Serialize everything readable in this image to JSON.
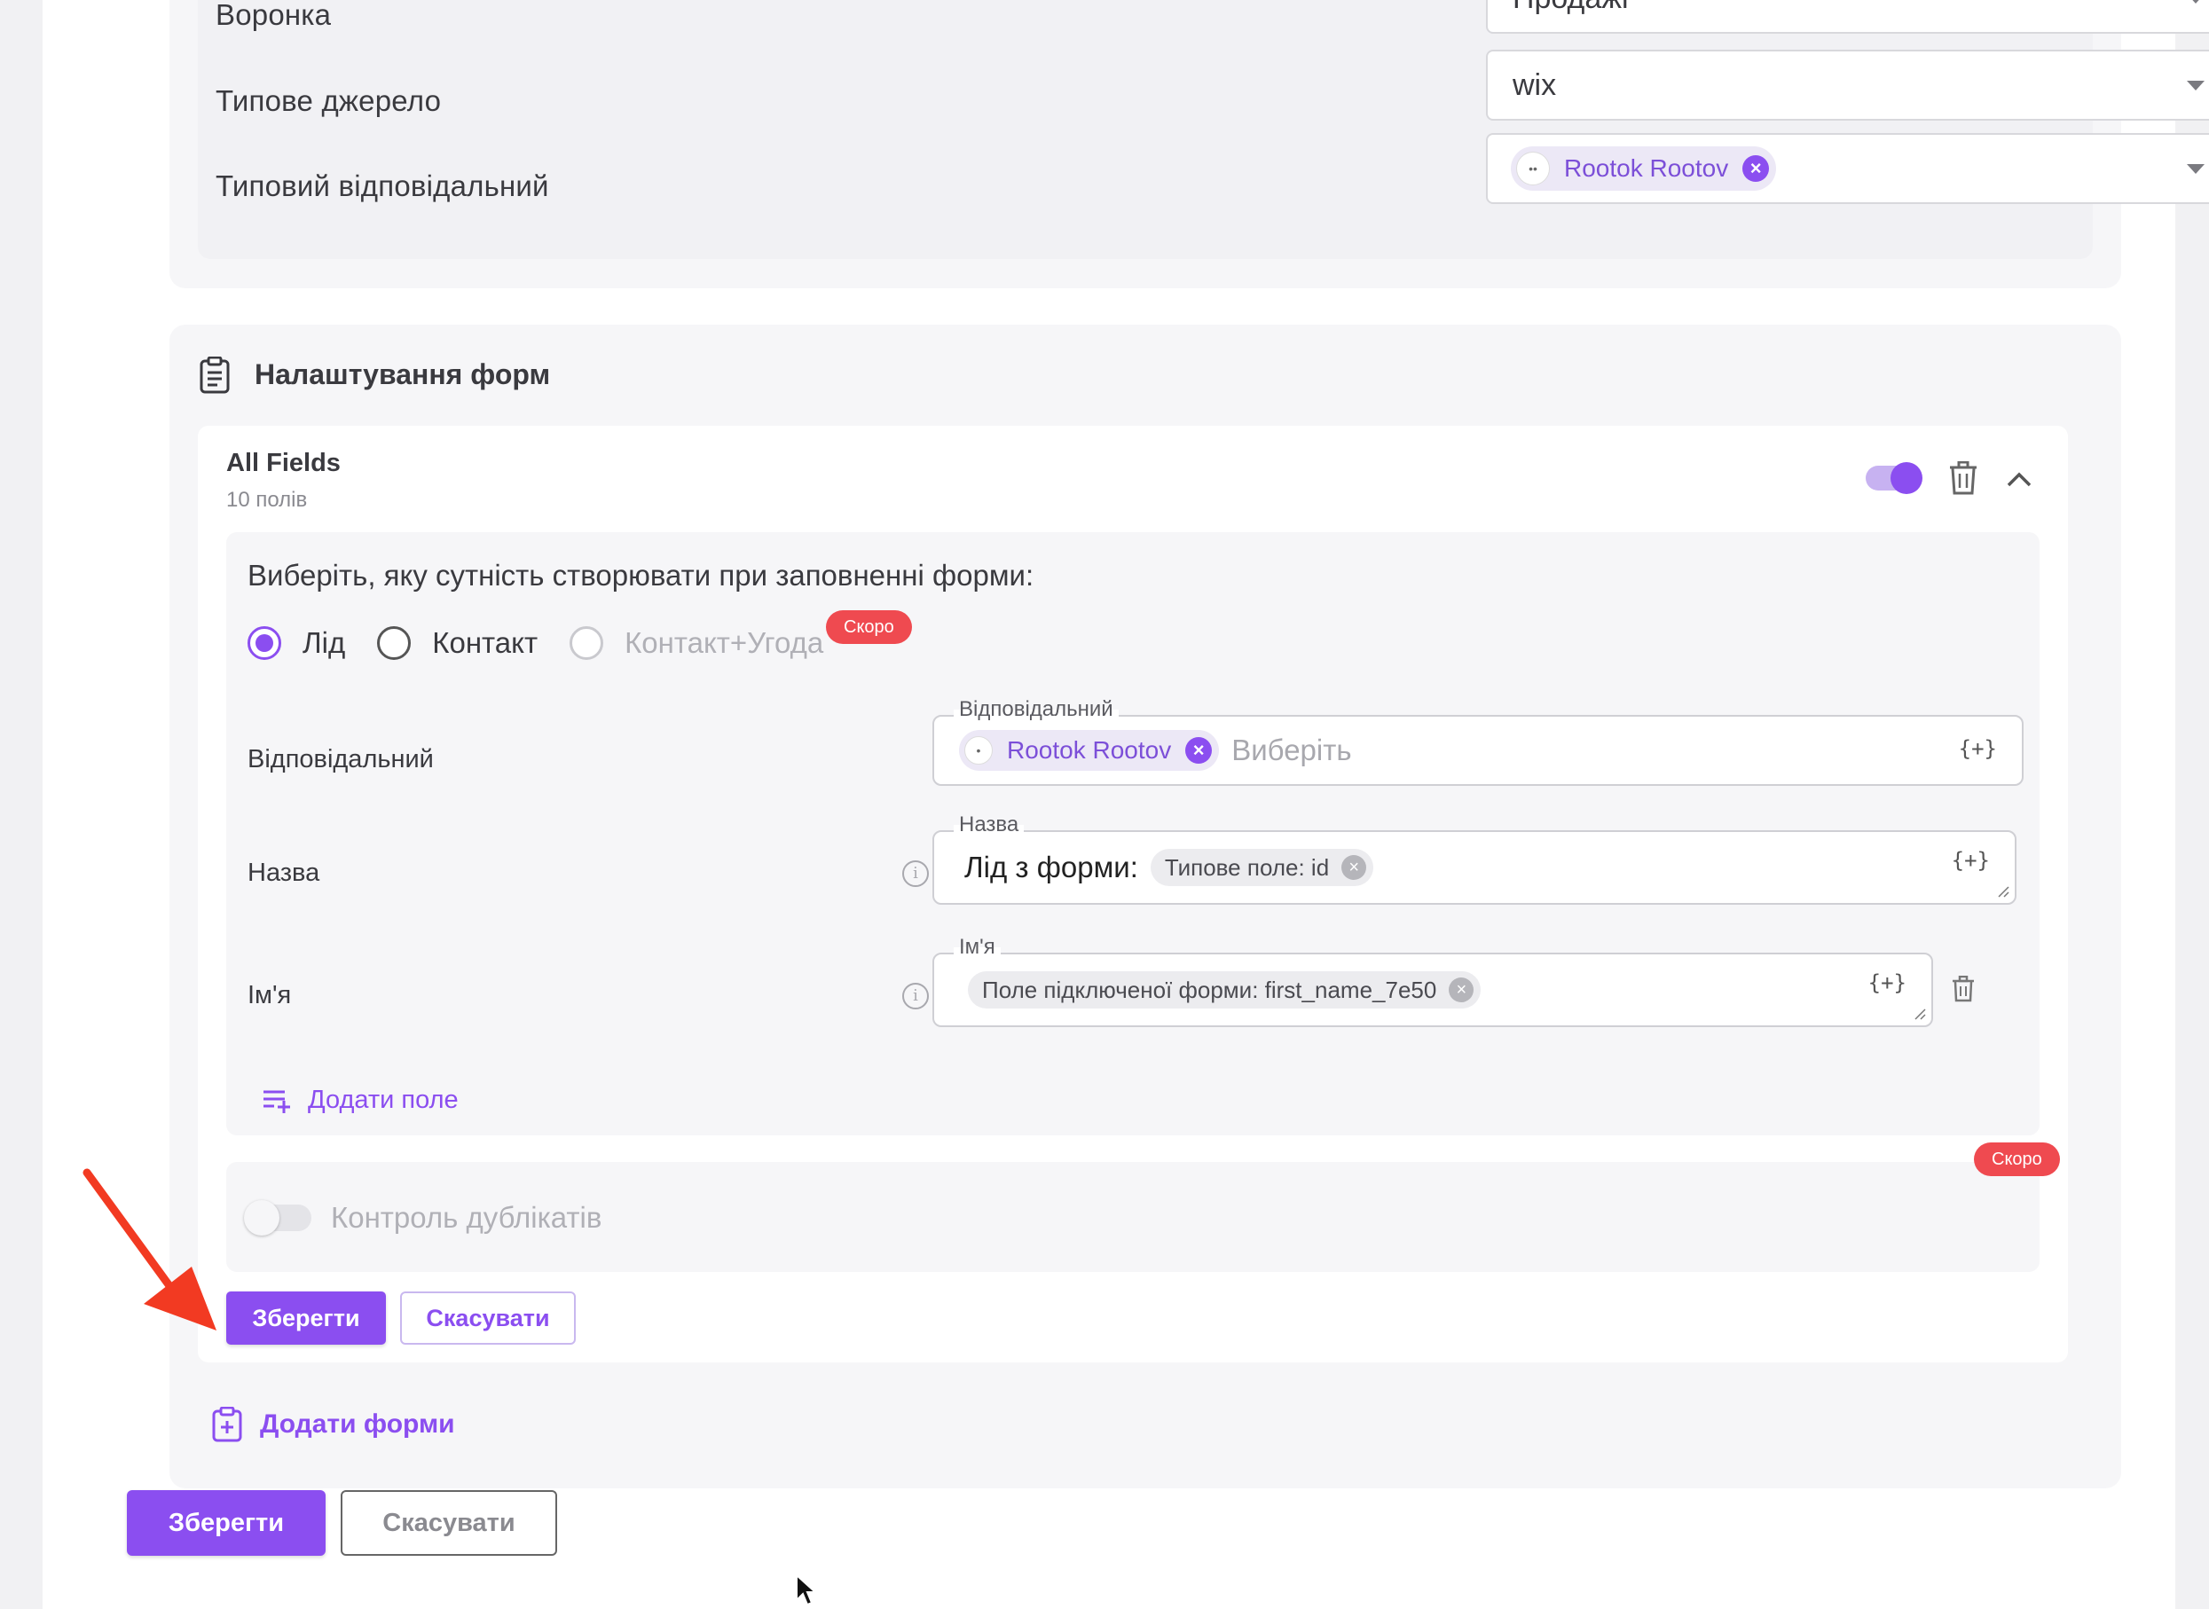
{
  "top_settings": {
    "funnel": {
      "label": "Воронка",
      "value": "Продажі"
    },
    "source": {
      "label": "Типове джерело",
      "value": "wix"
    },
    "responsible": {
      "label": "Типовий відповідальний",
      "chip": "Rootok Rootov"
    }
  },
  "forms_settings": {
    "title": "Налаштування форм",
    "form": {
      "name": "All Fields",
      "field_count": "10 полів",
      "enabled": true,
      "question": "Виберіть, яку сутність створювати при заповненні форми:",
      "entity_options": [
        {
          "label": "Лід",
          "selected": true,
          "disabled": false
        },
        {
          "label": "Контакт",
          "selected": false,
          "disabled": false
        },
        {
          "label": "Контакт+Угода",
          "selected": false,
          "disabled": true
        }
      ],
      "soon_badge": "Скоро",
      "fields": {
        "responsible": {
          "row_label": "Відповідальний",
          "legend": "Відповідальний",
          "chip": "Rootok Rootov",
          "placeholder": "Виберіть",
          "var_button": "{+}"
        },
        "name": {
          "row_label": "Назва",
          "legend": "Назва",
          "prefix_text": "Лід з форми:",
          "tag": "Типове поле: id",
          "var_button": "{+}"
        },
        "first_name": {
          "row_label": "Ім'я",
          "legend": "Ім'я",
          "tag": "Поле підключеної форми: first_name_7e50",
          "var_button": "{+}"
        }
      },
      "add_field": "Додати поле",
      "duplicate_control": {
        "label": "Контроль дублікатів",
        "enabled": false,
        "badge": "Скоро"
      },
      "save_button": "Зберегти",
      "cancel_button": "Скасувати"
    },
    "add_forms": "Додати форми"
  },
  "footer": {
    "save_button": "Зберегти",
    "cancel_button": "Скасувати"
  },
  "colors": {
    "accent": "#8b4ef0",
    "badge": "#ef4a50",
    "annotation_arrow": "#f23a22"
  }
}
